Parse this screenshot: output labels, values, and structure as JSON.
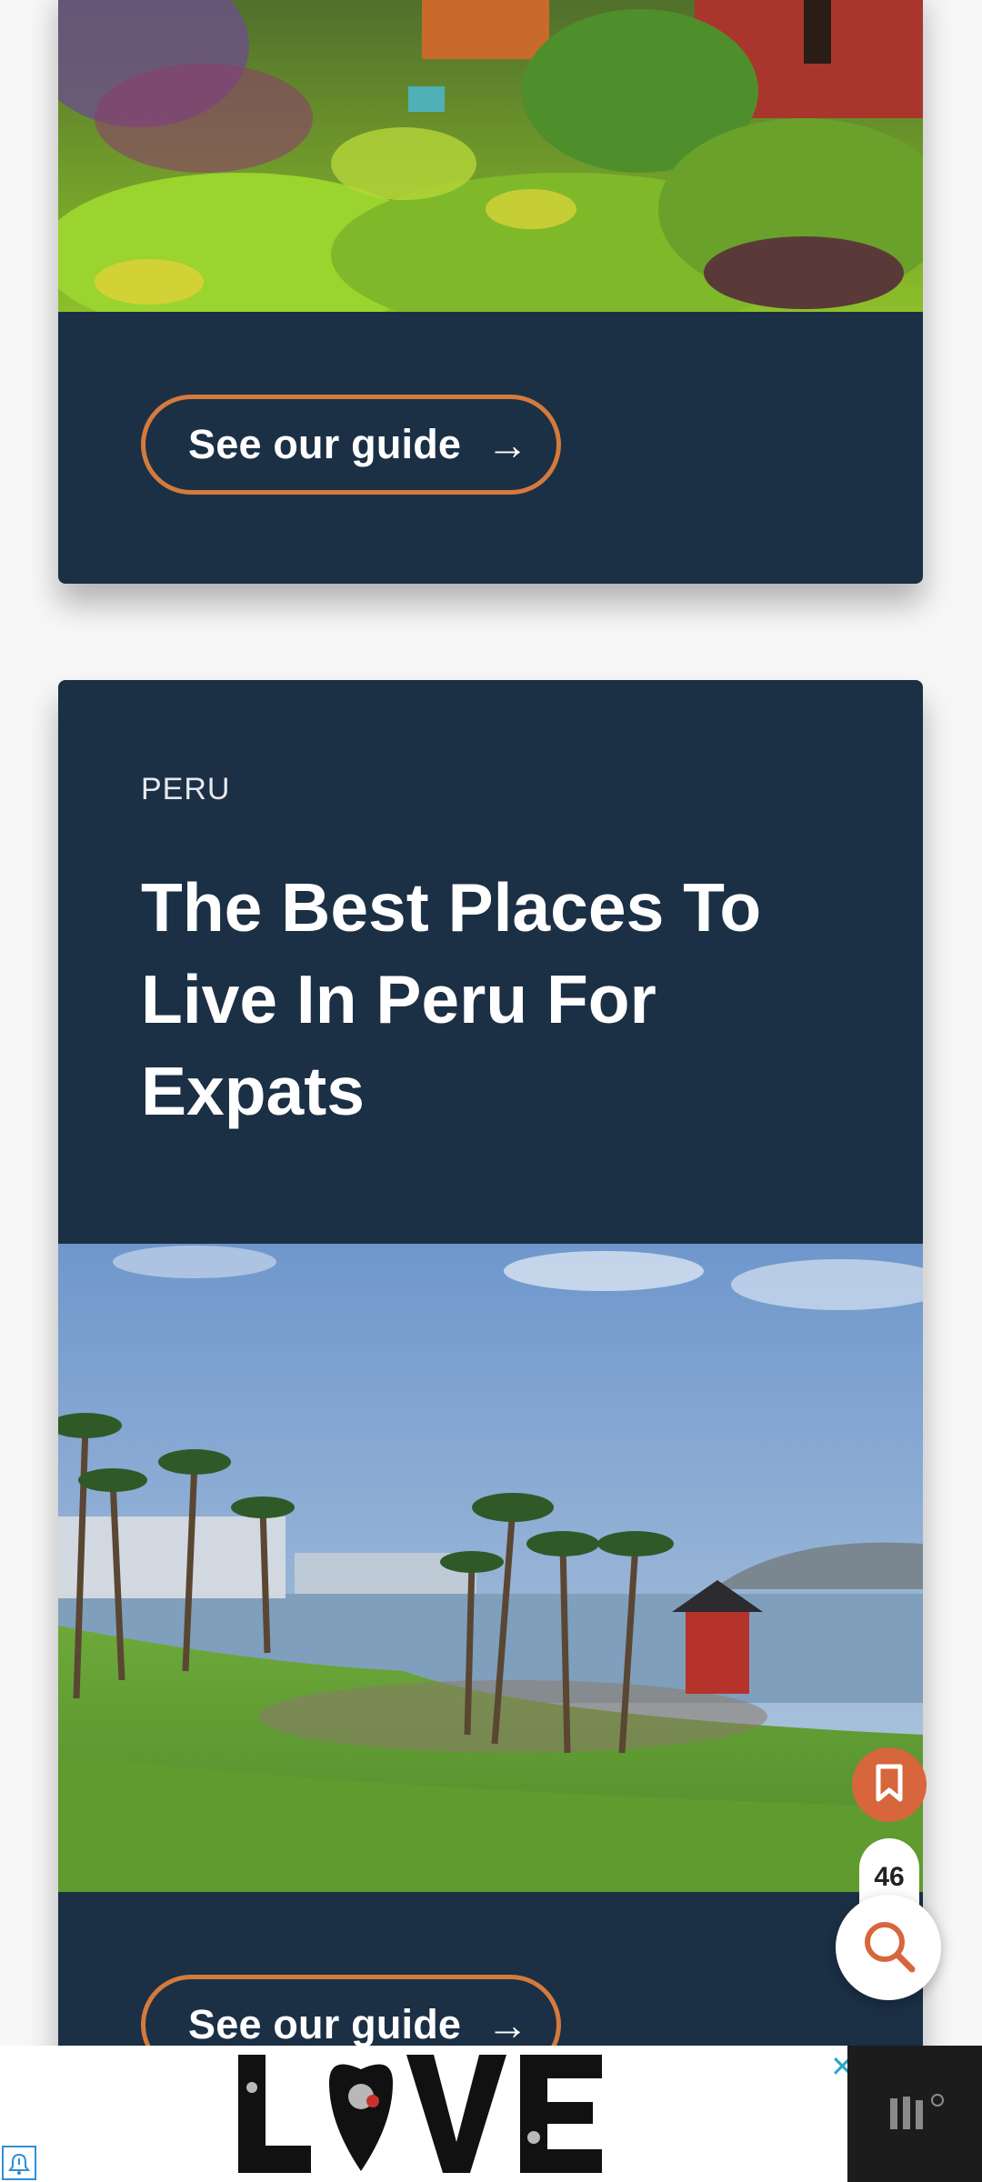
{
  "card_previous": {
    "cta_label": "See our guide",
    "cta_arrow": "→"
  },
  "card_peru": {
    "eyebrow": "PERU",
    "headline": "The Best Places To Live In Peru For Expats",
    "cta_label": "See our guide",
    "cta_arrow": "→"
  },
  "floating": {
    "bookmark_icon": "bookmark-icon",
    "count": "46",
    "search_icon": "search-icon"
  },
  "ad": {
    "art_text": "LOVE",
    "close_glyph": "✕",
    "logo_icon": "publisher-logo-icon",
    "info_icon": "ad-choices-icon"
  },
  "colors": {
    "card_bg": "#1b2f45",
    "accent": "#d47a3c",
    "fab_bookmark": "#d8663c"
  }
}
